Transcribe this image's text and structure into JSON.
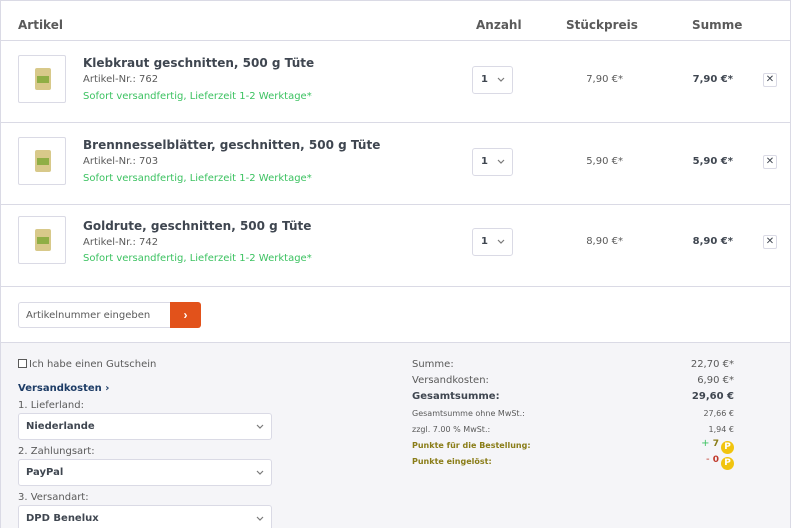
{
  "header": {
    "col_article": "Artikel",
    "col_qty": "Anzahl",
    "col_unit": "Stückpreis",
    "col_total": "Summe"
  },
  "items": [
    {
      "name": "Klebkraut geschnitten, 500 g Tüte",
      "sku": "Artikel-Nr.: 762",
      "availability": "Sofort versandfertig, Lieferzeit 1-2 Werktage*",
      "qty": "1",
      "unit_price": "7,90 €*",
      "total": "7,90 €*"
    },
    {
      "name": "Brennnesselblätter, geschnitten, 500 g Tüte",
      "sku": "Artikel-Nr.: 703",
      "availability": "Sofort versandfertig, Lieferzeit 1-2 Werktage*",
      "qty": "1",
      "unit_price": "5,90 €*",
      "total": "5,90 €*"
    },
    {
      "name": "Goldrute, geschnitten, 500 g Tüte",
      "sku": "Artikel-Nr.: 742",
      "availability": "Sofort versandfertig, Lieferzeit 1-2 Werktage*",
      "qty": "1",
      "unit_price": "8,90 €*",
      "total": "8,90 €*"
    }
  ],
  "remove_icon": "close-icon",
  "add_article": {
    "placeholder": "Artikelnummer eingeben",
    "button_icon": "chevron-right-icon",
    "button_label": "›"
  },
  "footer": {
    "voucher_label": "Ich habe einen Gutschein",
    "shipping_link": "Versandkosten ›",
    "country_label": "1. Lieferland:",
    "country_value": "Niederlande",
    "payment_label": "2. Zahlungsart:",
    "payment_value": "PayPal",
    "shipping_label": "3. Versandart:",
    "shipping_value": "DPD Benelux"
  },
  "summary": {
    "subtotal_label": "Summe:",
    "subtotal_value": "22,70 €*",
    "shipping_label": "Versandkosten:",
    "shipping_value": "6,90 €*",
    "grand_label": "Gesamtsumme:",
    "grand_value": "29,60 €",
    "net_label": "Gesamtsumme ohne MwSt.:",
    "net_value": "27,66 €",
    "vat_label": "zzgl. 7.00 % MwSt.:",
    "vat_value": "1,94 €",
    "points_order_label": "Punkte für die Bestellung:",
    "points_order_sign": "+",
    "points_order_value": "7",
    "points_used_label": "Punkte eingelöst:",
    "points_used_sign": "-",
    "points_used_value": "0",
    "coin_letter": "P"
  },
  "colors": {
    "accent": "#e2521b",
    "availability": "#3cc261",
    "link": "#1d3c66",
    "points": "#8a7d18",
    "coin": "#f1c40f"
  }
}
